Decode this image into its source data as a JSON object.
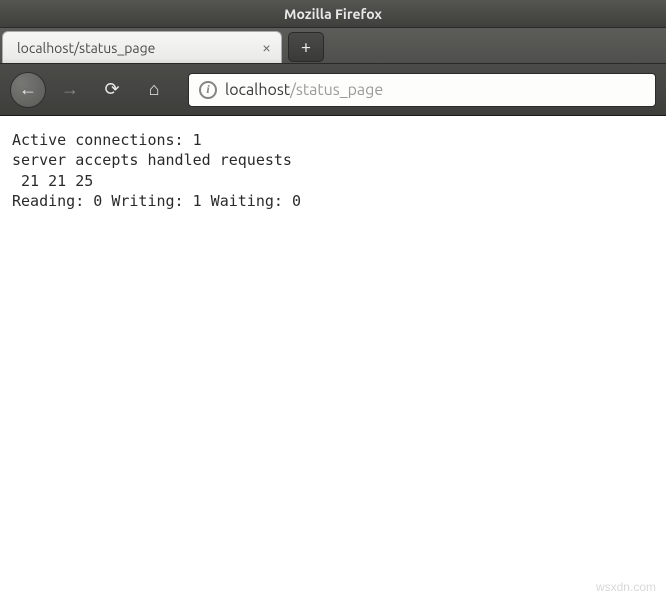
{
  "window": {
    "title": "Mozilla Firefox"
  },
  "tabs": {
    "active": {
      "label": "localhost/status_page"
    },
    "new_glyph": "+"
  },
  "nav": {
    "back_glyph": "←",
    "forward_glyph": "→",
    "reload_glyph": "⟳",
    "home_glyph": "⌂"
  },
  "urlbar": {
    "info_glyph": "i",
    "host": "localhost",
    "path": "/status_page"
  },
  "page": {
    "line1_prefix": "Active connections: ",
    "active_connections": "1",
    "line2": "server accepts handled requests",
    "counts": " 21 21 25",
    "line4_r_label": "Reading: ",
    "reading": "0",
    "line4_w_label": " Writing: ",
    "writing": "1",
    "line4_wa_label": " Waiting: ",
    "waiting": "0"
  },
  "watermark": "wsxdn.com"
}
